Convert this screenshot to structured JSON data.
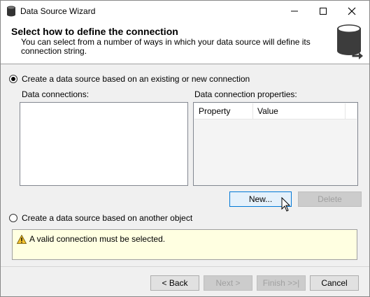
{
  "window": {
    "title": "Data Source Wizard",
    "icons": [
      "database-icon",
      "minimize-icon",
      "maximize-icon",
      "close-icon"
    ]
  },
  "header": {
    "title": "Select how to define the connection",
    "description": "You can select from a number of ways in which your data source will define its connection string."
  },
  "options": {
    "existing": {
      "label": "Create a data source based on an existing or new connection",
      "selected": true
    },
    "other": {
      "label": "Create a data source based on another object",
      "selected": false
    }
  },
  "data_connections": {
    "label": "Data connections:"
  },
  "properties": {
    "label": "Data connection properties:",
    "columns": [
      "Property",
      "Value"
    ]
  },
  "buttons": {
    "new": "New...",
    "delete": "Delete",
    "back": "< Back",
    "next": "Next >",
    "finish": "Finish >>|",
    "cancel": "Cancel"
  },
  "warning": {
    "text": "A valid connection must be selected."
  }
}
